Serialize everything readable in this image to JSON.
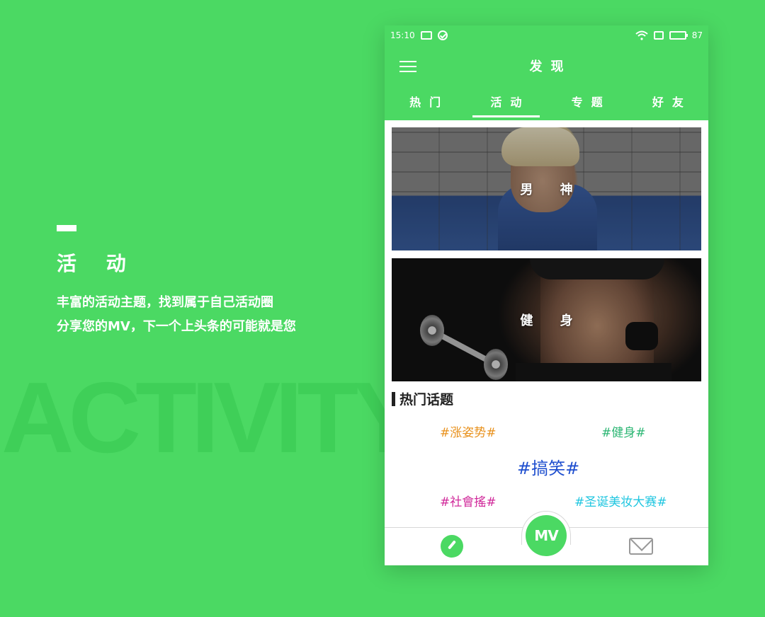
{
  "background_word": "ACTIVITY",
  "intro": {
    "title": "活 动",
    "lines": [
      "丰富的活动主题，找到属于自己活动圈",
      "分享您的MV，下一个上头条的可能就是您"
    ]
  },
  "status_bar": {
    "time": "15:10",
    "battery": "87"
  },
  "header": {
    "title": "发现"
  },
  "tabs": [
    {
      "label": "热门"
    },
    {
      "label": "活动",
      "active": true
    },
    {
      "label": "专题"
    },
    {
      "label": "好友"
    }
  ],
  "banners": [
    {
      "label": "男 神"
    },
    {
      "label": "健 身"
    }
  ],
  "hot_topics": {
    "title": "热门话题",
    "tags": [
      {
        "text": "#涨姿势#",
        "color": "#e8911c"
      },
      {
        "text": "#健身#",
        "color": "#2bb673"
      },
      {
        "text": "#搞笑#",
        "color": "#1f4fcf"
      },
      {
        "text": "#社會搖#",
        "color": "#d0289a"
      },
      {
        "text": "#圣诞美妆大赛#",
        "color": "#1fc6e0"
      }
    ]
  },
  "bottom_nav": {
    "center_icon": "mv-camera-icon",
    "left_icon": "compass-icon",
    "right_icon": "mail-icon",
    "center_label": "MV"
  },
  "colors": {
    "accent": "#4bd963"
  }
}
